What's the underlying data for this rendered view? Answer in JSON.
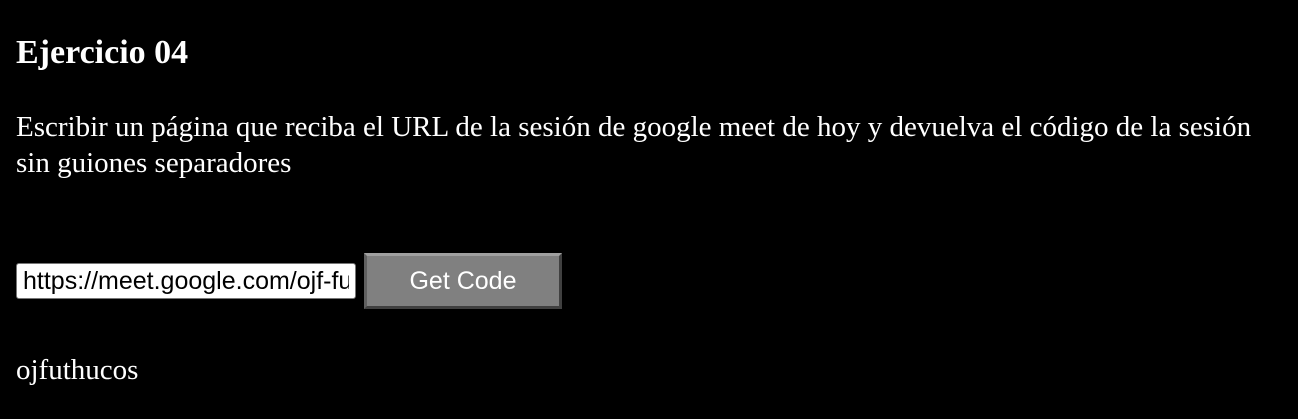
{
  "heading": "Ejercicio 04",
  "description": "Escribir un página que reciba el URL de la sesión de google meet de hoy y devuelva el código de la sesión sin guiones separadores",
  "form": {
    "url_value": "https://meet.google.com/ojf-futh-ucos",
    "button_label": "Get Code"
  },
  "result": "ojfuthucos"
}
